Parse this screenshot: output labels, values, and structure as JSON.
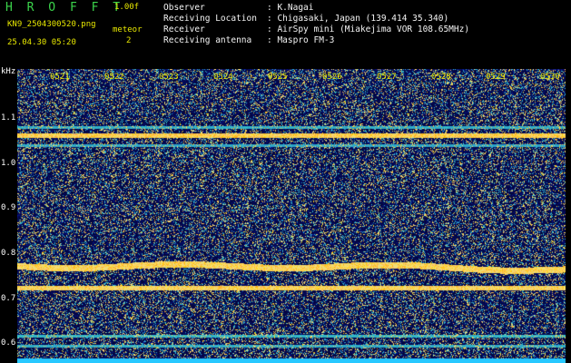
{
  "header": {
    "app_title": "H R O F F T",
    "version": "1.00f",
    "file_name": "KN9_2504300520.png",
    "meteor_label": "meteor",
    "meteor_count": "2",
    "date_time": "25.04.30 05:20"
  },
  "info": [
    {
      "key": "Observer",
      "value": ": K.Nagai"
    },
    {
      "key": "Receiving Location",
      "value": ": Chigasaki, Japan (139.414 35.340)"
    },
    {
      "key": "Receiver",
      "value": ": AirSpy mini (Miakejima VOR 108.65MHz)"
    },
    {
      "key": "Receiving antenna",
      "value": ": Maspro FM-3"
    }
  ],
  "axis": {
    "unit": "kHz",
    "time_labels": [
      "0521",
      "0522",
      "0523",
      "0524",
      "0525",
      "0526",
      "0527",
      "0528",
      "0529",
      "0530"
    ],
    "freq_labels": [
      "1.1",
      "1.0",
      "0.9",
      "0.8",
      "0.7",
      "0.6"
    ]
  },
  "colors": {
    "background": "#000000",
    "header_green": "#3bd44b",
    "header_yellow": "#e8e800",
    "noise_base": "#08084a",
    "baseline_cyan": "#2ed2ff"
  }
}
